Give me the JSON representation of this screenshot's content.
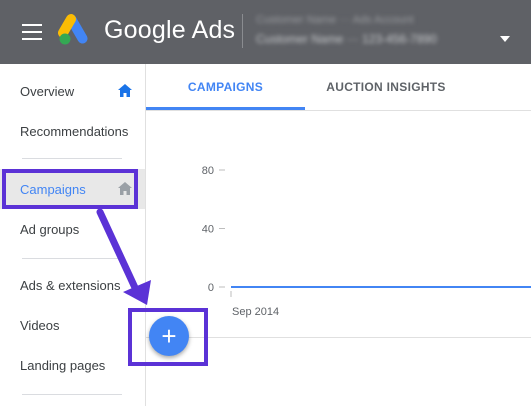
{
  "header": {
    "brand": "Google Ads",
    "account_name_blurred": "Customer Name ··· Ads Account",
    "account_id_blurred": "Customer Name ··· 123-456-7890",
    "bg_color": "#5f6166"
  },
  "sidebar": {
    "items": [
      {
        "label": "Overview",
        "icon": "home-icon"
      },
      {
        "label": "Recommendations"
      },
      {
        "label": "Campaigns",
        "icon": "home-icon",
        "active": true
      },
      {
        "label": "Ad groups"
      },
      {
        "label": "Ads & extensions"
      },
      {
        "label": "Videos"
      },
      {
        "label": "Landing pages"
      }
    ]
  },
  "tabs": [
    {
      "label": "CAMPAIGNS",
      "active": true
    },
    {
      "label": "AUCTION INSIGHTS",
      "active": false
    }
  ],
  "chart_data": {
    "type": "line",
    "y_ticks": [
      "80",
      "40",
      "0"
    ],
    "x_ticks": [
      "Sep 2014"
    ],
    "ylim": [
      0,
      80
    ],
    "series": [
      {
        "values": [
          0,
          0
        ]
      }
    ],
    "line_color": "#4285f4"
  },
  "fab": {
    "label": "+",
    "color": "#4285f4"
  },
  "annotation": {
    "color": "#5b32d6"
  }
}
